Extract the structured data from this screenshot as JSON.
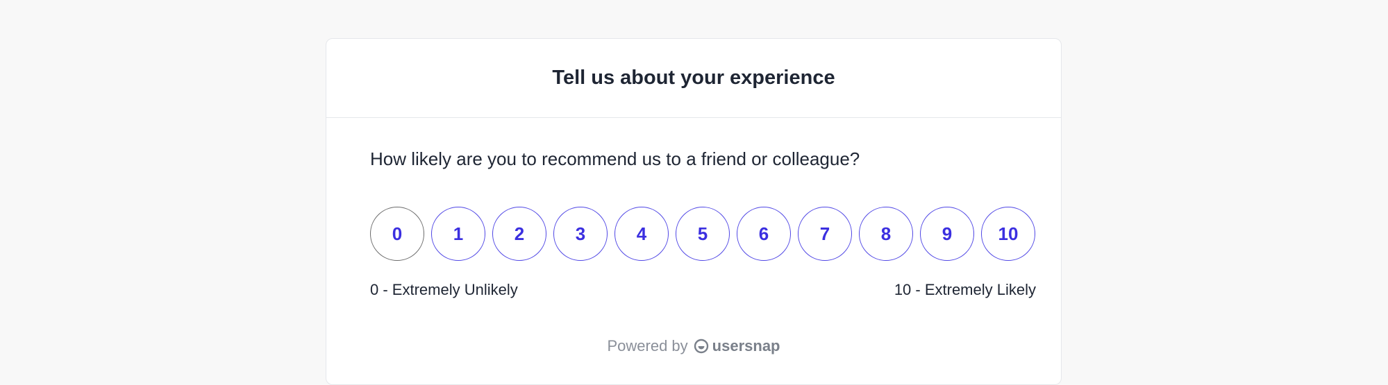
{
  "survey": {
    "title": "Tell us about your experience",
    "question": "How likely are you to recommend us to a friend or colleague?",
    "scale": [
      "0",
      "1",
      "2",
      "3",
      "4",
      "5",
      "6",
      "7",
      "8",
      "9",
      "10"
    ],
    "legend_low": "0 - Extremely Unlikely",
    "legend_high": "10 - Extremely Likely",
    "accent_color": "#4f46e5"
  },
  "footer": {
    "powered_by": "Powered by",
    "brand_name": "usersnap",
    "brand_icon": "usersnap-logo-icon"
  }
}
